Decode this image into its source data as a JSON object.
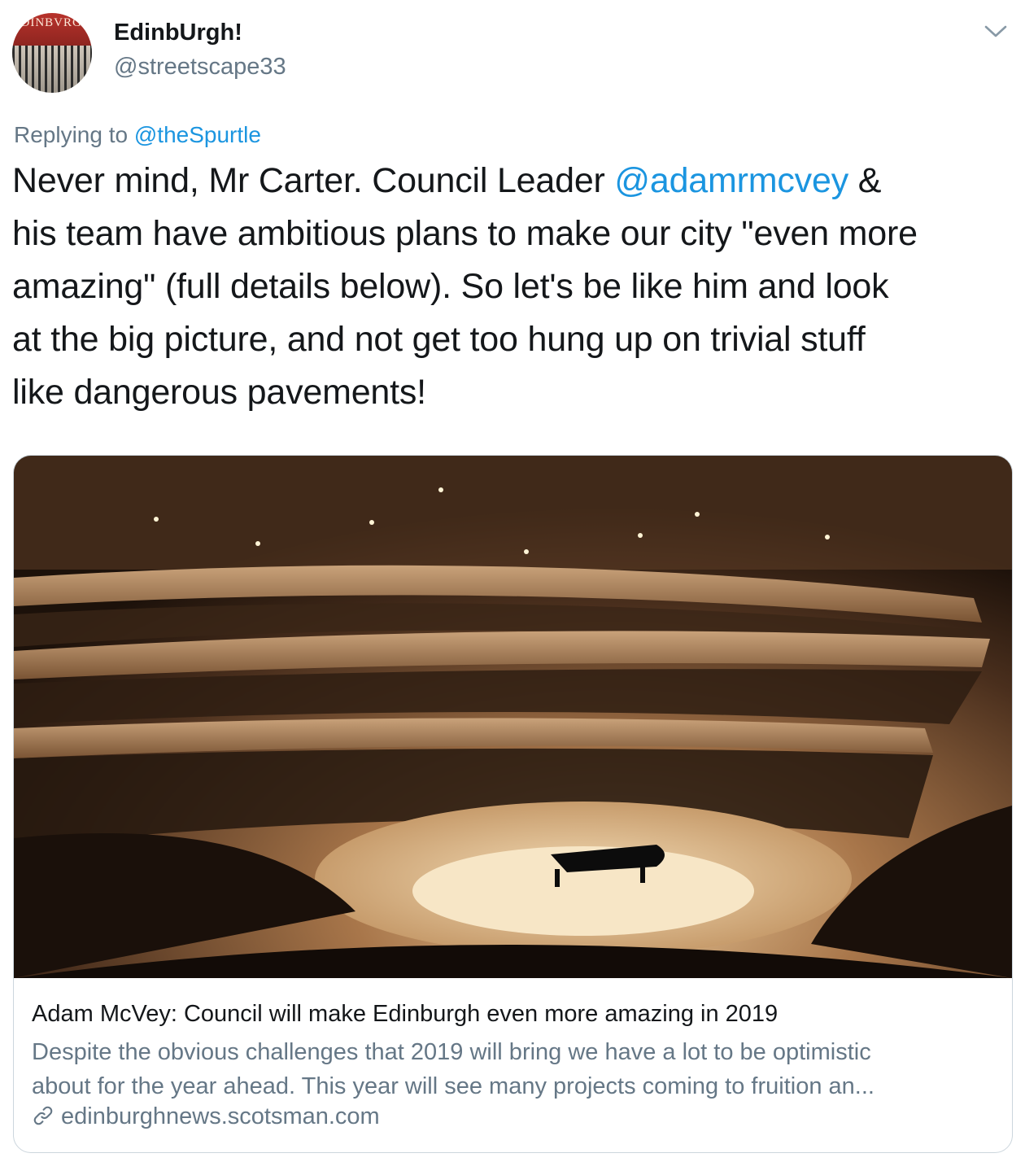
{
  "header": {
    "display_name": "EdinbUrgh!",
    "handle": "@streetscape33",
    "avatar_sign_text": "EDINBVRGH"
  },
  "reply": {
    "prefix": "Replying to ",
    "mention": "@theSpurtle"
  },
  "tweet": {
    "lines": [
      {
        "before": "Never mind, Mr Carter. Council Leader ",
        "mention": "@adamrmcvey",
        "after": " &"
      },
      {
        "text": "his team have ambitious plans to make our city \"even more"
      },
      {
        "text": "amazing\" (full details below). So let's be like him and look"
      },
      {
        "text": "at the big picture, and not get too hung up on trivial stuff"
      },
      {
        "text": "like dangerous pavements!"
      }
    ]
  },
  "card": {
    "title": "Adam McVey: Council will make Edinburgh even more amazing in 2019",
    "description_lines": [
      "Despite the obvious challenges that 2019 will bring we have a lot to be optimistic",
      "about for the year ahead. This year will see many projects coming to fruition an..."
    ],
    "domain": "edinburghnews.scotsman.com",
    "image_alt": "concert hall with grand piano and tiered audience balconies"
  },
  "icons": {
    "caret": "chevron-down-icon",
    "link": "link-icon"
  },
  "colors": {
    "text": "#14171a",
    "secondary": "#657786",
    "link": "#1b95e0",
    "border": "#ccd6dd"
  }
}
